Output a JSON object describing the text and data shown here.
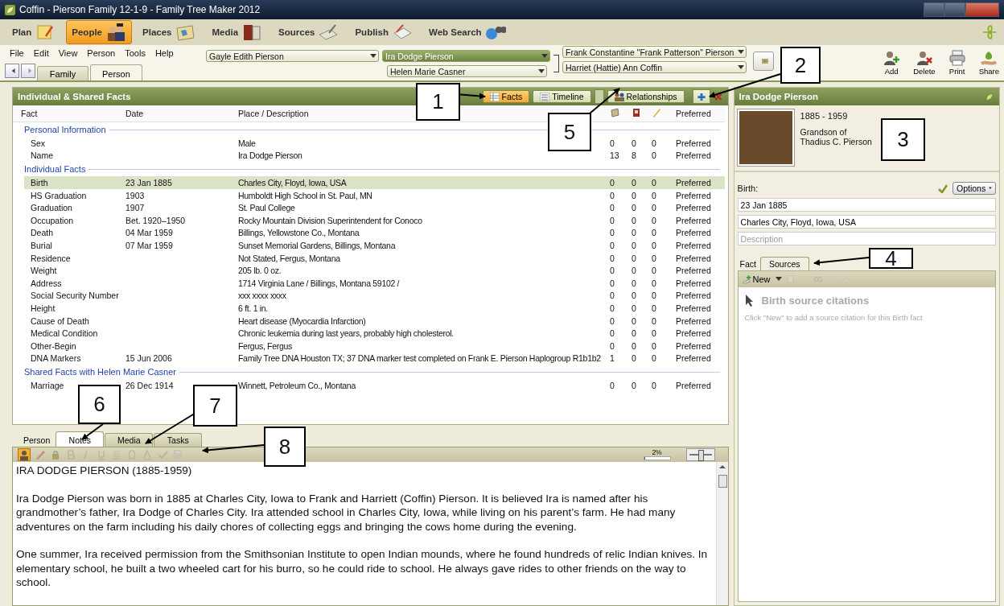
{
  "window": {
    "title": "Coffin - Pierson Family 12-1-9 - Family Tree Maker 2012"
  },
  "workspaces": [
    {
      "label": "Plan",
      "selected": false
    },
    {
      "label": "People",
      "selected": true
    },
    {
      "label": "Places",
      "selected": false
    },
    {
      "label": "Media",
      "selected": false
    },
    {
      "label": "Sources",
      "selected": false
    },
    {
      "label": "Publish",
      "selected": false
    },
    {
      "label": "Web Search",
      "selected": false
    }
  ],
  "menu": [
    "File",
    "Edit",
    "View",
    "Person",
    "Tools",
    "Help"
  ],
  "view_tabs": [
    {
      "label": "Family",
      "selected": false
    },
    {
      "label": "Person",
      "selected": true
    }
  ],
  "family": {
    "person_left": "Gayle Edith Pierson",
    "focus_person": "Ira Dodge Pierson",
    "spouse": "Helen Marie Casner",
    "father": "Frank Constantine \"Frank Patterson\" Pierson",
    "mother": "Harriet (Hattie) Ann Coffin"
  },
  "actions": [
    "Add",
    "Delete",
    "Print",
    "Share"
  ],
  "facts_panel": {
    "title": "Individual & Shared Facts",
    "views": [
      {
        "label": "Facts",
        "selected": true
      },
      {
        "label": "Timeline",
        "selected": false
      },
      {
        "label": "Relationships",
        "selected": false
      }
    ],
    "columns": [
      "Fact",
      "Date",
      "Place / Description",
      "Preferred"
    ],
    "sections": [
      {
        "title": "Personal Information",
        "rows": [
          {
            "fact": "Sex",
            "date": "",
            "place": "Male",
            "sources": "0",
            "media": "0",
            "notes": "0",
            "preferred": "Preferred",
            "selected": false
          },
          {
            "fact": "Name",
            "date": "",
            "place": "Ira Dodge Pierson",
            "sources": "13",
            "media": "8",
            "notes": "0",
            "preferred": "Preferred",
            "selected": false
          }
        ]
      },
      {
        "title": "Individual Facts",
        "rows": [
          {
            "fact": "Birth",
            "date": "23 Jan 1885",
            "place": "Charles City, Floyd, Iowa, USA",
            "sources": "0",
            "media": "0",
            "notes": "0",
            "preferred": "Preferred",
            "selected": true
          },
          {
            "fact": "HS Graduation",
            "date": "1903",
            "place": "Humboldt High School in St. Paul, MN",
            "sources": "0",
            "media": "0",
            "notes": "0",
            "preferred": "Preferred",
            "selected": false
          },
          {
            "fact": "Graduation",
            "date": "1907",
            "place": "St. Paul College",
            "sources": "0",
            "media": "0",
            "notes": "0",
            "preferred": "Preferred",
            "selected": false
          },
          {
            "fact": "Occupation",
            "date": "Bet. 1920–1950",
            "place": "Rocky Mountain Division Superintendent for Conoco",
            "sources": "0",
            "media": "0",
            "notes": "0",
            "preferred": "Preferred",
            "selected": false
          },
          {
            "fact": "Death",
            "date": "04 Mar 1959",
            "place": "Billings, Yellowstone Co., Montana",
            "sources": "0",
            "media": "0",
            "notes": "0",
            "preferred": "Preferred",
            "selected": false
          },
          {
            "fact": "Burial",
            "date": "07 Mar 1959",
            "place": "Sunset Memorial Gardens, Billings, Montana",
            "sources": "0",
            "media": "0",
            "notes": "0",
            "preferred": "Preferred",
            "selected": false
          },
          {
            "fact": "Residence",
            "date": "",
            "place": "Not Stated, Fergus, Montana",
            "sources": "0",
            "media": "0",
            "notes": "0",
            "preferred": "Preferred",
            "selected": false
          },
          {
            "fact": "Weight",
            "date": "",
            "place": "205 lb. 0 oz.",
            "sources": "0",
            "media": "0",
            "notes": "0",
            "preferred": "Preferred",
            "selected": false
          },
          {
            "fact": "Address",
            "date": "",
            "place": "1714 Virginia Lane / Billings, Montana 59102 /",
            "sources": "0",
            "media": "0",
            "notes": "0",
            "preferred": "Preferred",
            "selected": false
          },
          {
            "fact": "Social Security Number",
            "date": "",
            "place": "xxx xxxx xxxx",
            "sources": "0",
            "media": "0",
            "notes": "0",
            "preferred": "Preferred",
            "selected": false
          },
          {
            "fact": "Height",
            "date": "",
            "place": "6 ft. 1 in.",
            "sources": "0",
            "media": "0",
            "notes": "0",
            "preferred": "Preferred",
            "selected": false
          },
          {
            "fact": "Cause of Death",
            "date": "",
            "place": "Heart disease (Myocardia Infarction)",
            "sources": "0",
            "media": "0",
            "notes": "0",
            "preferred": "Preferred",
            "selected": false
          },
          {
            "fact": "Medical Condition",
            "date": "",
            "place": "Chronic leukemia during last years, probably high cholesterol.",
            "sources": "0",
            "media": "0",
            "notes": "0",
            "preferred": "Preferred",
            "selected": false
          },
          {
            "fact": "Other-Begin",
            "date": "",
            "place": "Fergus, Fergus",
            "sources": "0",
            "media": "0",
            "notes": "0",
            "preferred": "Preferred",
            "selected": false
          },
          {
            "fact": "DNA Markers",
            "date": "15 Jun 2006",
            "place": "Family Tree DNA Houston TX; 37 DNA marker test completed on Frank E. Pierson Haplogroup R1b1b2",
            "sources": "1",
            "media": "0",
            "notes": "0",
            "preferred": "Preferred",
            "selected": false
          }
        ]
      },
      {
        "title": "Shared Facts with Helen Marie Casner",
        "rows": [
          {
            "fact": "Marriage",
            "date": "26 Dec 1914",
            "place": "Winnett, Petroleum Co., Montana",
            "sources": "0",
            "media": "0",
            "notes": "0",
            "preferred": "Preferred",
            "selected": false
          }
        ]
      }
    ]
  },
  "bottom_tabs": [
    {
      "label": "Person",
      "selected": false
    },
    {
      "label": "Notes",
      "selected": true
    },
    {
      "label": "Media",
      "selected": false
    },
    {
      "label": "Tasks",
      "selected": false
    }
  ],
  "notes": {
    "usage": "2%",
    "usage_meter": {
      "level": 0.04
    },
    "zoom_slider": {
      "level": 0.5
    },
    "paragraphs": [
      "IRA DODGE PIERSON (1885-1959)",
      "Ira Dodge Pierson was born in 1885 at Charles City, Iowa to Frank and Harriett (Coffin) Pierson. It is believed Ira is named after his grandmother’s father, Ira Dodge of Charles City. Ira attended school in Charles City, Iowa, while living on his parent’s farm. He had many adventures on the farm including his daily chores of collecting eggs and bringing the cows home during the evening.",
      "One summer, Ira received permission from the Smithsonian Institute to open Indian mounds, where he found hundreds of relic Indian knives. In elementary school, he built a two wheeled cart for his burro, so he could ride to school. He always gave rides to other friends on the way to school."
    ]
  },
  "person_panel": {
    "title": "Ira Dodge Pierson",
    "lifespan": "1885 - 1959",
    "relation": "Grandson of\nThadius C. Pierson",
    "fact_label": "Birth:",
    "options": "Options",
    "date": "23 Jan 1885",
    "place": "Charles City, Floyd, Iowa, USA",
    "description_placeholder": "Description",
    "tabs": [
      {
        "label": "Fact",
        "selected": false
      },
      {
        "label": "Sources",
        "selected": true
      }
    ],
    "new_button": "New",
    "sources_title": "Birth source citations",
    "sources_hint": "Click \"New\" to add a source citation for this Birth fact"
  },
  "callouts": [
    "1",
    "2",
    "3",
    "4",
    "5",
    "6",
    "7",
    "8"
  ]
}
